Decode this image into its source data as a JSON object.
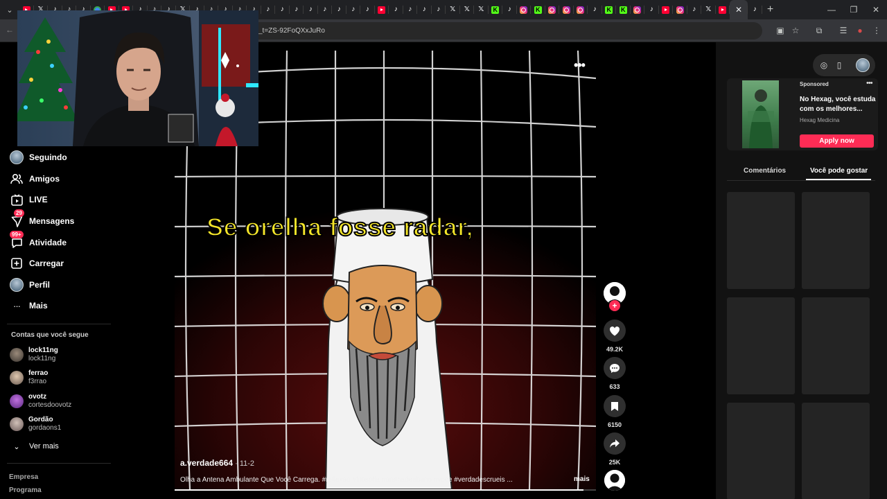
{
  "browser": {
    "tab_favicons": [
      "youtube",
      "x",
      "tiktok",
      "tiktok",
      "tiktok",
      "chrome",
      "youtube",
      "youtube",
      "tiktok",
      "tiktok",
      "tiktok",
      "x",
      "tiktok",
      "tiktok",
      "tiktok",
      "tiktok",
      "tiktok",
      "tiktok",
      "tiktok",
      "tiktok",
      "tiktok",
      "tiktok",
      "tiktok",
      "tiktok",
      "tiktok",
      "youtube",
      "tiktok",
      "tiktok",
      "tiktok",
      "tiktok",
      "x",
      "x",
      "x",
      "kick",
      "tiktok",
      "instagram",
      "kick",
      "instagram",
      "instagram",
      "instagram",
      "tiktok",
      "kick",
      "kick",
      "instagram",
      "tiktok",
      "youtube",
      "instagram",
      "tiktok",
      "x",
      "youtube"
    ],
    "active_tab_close": "✕",
    "new_tab": "+",
    "address_text": "_t=ZS-92FoQXxJuRo",
    "window_controls": [
      "—",
      "❐",
      "✕"
    ]
  },
  "sidebar": {
    "items": [
      {
        "label": "Seguindo",
        "icon": "following-avatar-icon"
      },
      {
        "label": "Amigos",
        "icon": "friends-icon"
      },
      {
        "label": "LIVE",
        "icon": "live-icon"
      },
      {
        "label": "Mensagens",
        "icon": "messages-icon",
        "badge": "29"
      },
      {
        "label": "Atividade",
        "icon": "activity-icon",
        "badge": "99+"
      },
      {
        "label": "Carregar",
        "icon": "upload-icon"
      },
      {
        "label": "Perfil",
        "icon": "profile-avatar-icon"
      },
      {
        "label": "Mais",
        "icon": "more-icon"
      }
    ],
    "following_title": "Contas que você segue",
    "following": [
      {
        "name": "lock11ng",
        "handle": "lock11ng"
      },
      {
        "name": "ferrao",
        "handle": "f3rrao"
      },
      {
        "name": "ovotz",
        "handle": "cortesdoovotz"
      },
      {
        "name": "Gordão",
        "handle": "gordaons1"
      }
    ],
    "see_more": "Ver mais",
    "footer": [
      "Empresa",
      "Programa"
    ]
  },
  "video": {
    "caption": "Se orelha fosse radar,",
    "author": "a.verdade664",
    "date": " · 11-2",
    "description": "Olha a Antena Ambulante Que Você Carrega. #reflexão #filosofia #orelhadeabano #voce #verdadescrueis ...",
    "more": "mais",
    "progress": 0.97
  },
  "actions": {
    "likes": "49.2K",
    "comments": "633",
    "saves": "6150",
    "shares": "25K"
  },
  "right_panel": {
    "ad": {
      "sponsored": "Sponsored",
      "title": "No Hexag, você estuda com os melhores...",
      "brand": "Hexag Medicina",
      "cta": "Apply now"
    },
    "tabs": [
      "Comentários",
      "Você pode gostar"
    ],
    "active_tab": "Você pode gostar"
  },
  "colors": {
    "accent": "#fe2c55",
    "caption_yellow": "#f5e62a"
  }
}
